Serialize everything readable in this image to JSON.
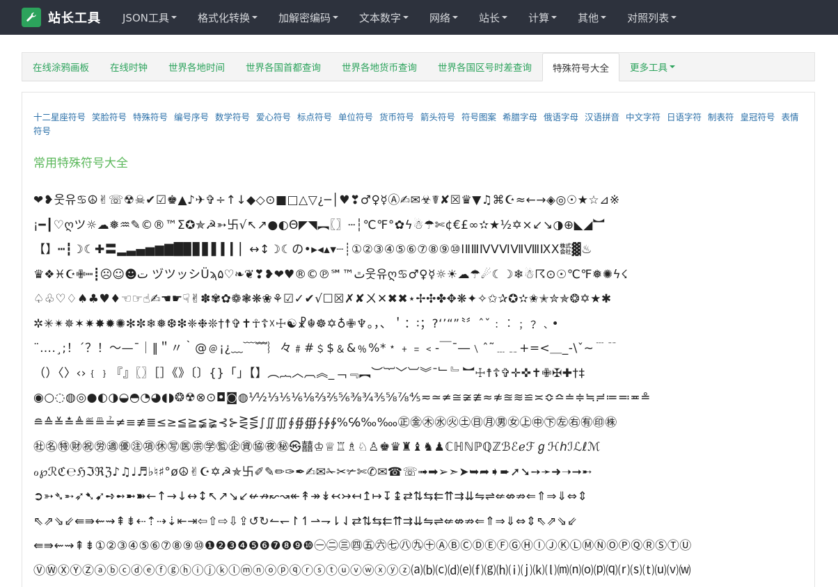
{
  "brand": {
    "name": "站长工具",
    "icon": "wrench-icon"
  },
  "nav": [
    "JSON工具",
    "格式化转换",
    "加解密编码",
    "文本数字",
    "网络",
    "站长",
    "计算",
    "其他",
    "对照列表"
  ],
  "tabs": [
    "在线涂鸦画板",
    "在线时钟",
    "世界各地时间",
    "世界各国首都查询",
    "世界各地货币查询",
    "世界各国区号时差查询",
    "特殊符号大全",
    "更多工具"
  ],
  "active_tab": "特殊符号大全",
  "categories": [
    "十二星座符号",
    "笑脸符号",
    "特殊符号",
    "编号序号",
    "数学符号",
    "爱心符号",
    "标点符号",
    "单位符号",
    "货币符号",
    "箭头符号",
    "符号图案",
    "希腊字母",
    "俄语字母",
    "汉语拼音",
    "中文字符",
    "日语字符",
    "制表符",
    "皇冠符号",
    "表情符号"
  ],
  "section_title": "常用特殊符号大全",
  "symbol_rows": [
    "❤❥웃유♋☮✌☏☢☠✔☑♚▲♪✈✞÷↑↓◆◇⊙■□△▽¿─│♥❣♂♀☿Ⓐ✍✉☣☤✘☒♛▼♫⌘☪≈←→◈◎☉★☆⊿※",
    "¡━┃♡ღツ☼☁❅♒✎©®™Σ✪✯☭➳卐√↖↗●◐Θ◤◥︻〖〗┄┆℃℉°✿ϟ☃☂✄¢€£∞✫★½✡×↙↘◑⊕◣◢︼",
    "【】┅┇☽☾✚〓▂▃▄▅▆▇█▉▊▋▌▍▎▏↔↕☽☾の•▸◂▴▾┈┊①②③④⑤⑥⑦⑧⑨⑩ⅠⅡⅢⅣⅤⅥⅦⅧⅨⅩ㍿▓♨",
    "♛❖♓☪✙┉┋☹☺☻ت ヅツッシÜϡﭢ™℠℗©®♥❤❥❣❦❧♡۵웃유ღ♋♂♀☿☼☀☁☂☄☾☽❄☃☈⊙☉℃℉❅✺ϟ☇",
    "♤♧♡♢♠♣♥♦☜☞☝✍☚☛☟✌✽✾✿❁❃❋❀⚘☑✓✔√☐☒✗✘ㄨ✕✖✖⋆✢✣✤✥❋✦✧✩✰✪✫✬✭✮✯❂✡★✱",
    "✲✳✴✵✶✷✸✹✺✻✼❄❅❆❇❈❉❊†☨✞✝☥☦☓☩☯☧☬☸✡♁✙♆。，、＇：∶；?‘’“”〝〞ˆˇ﹕︰﹔﹖﹑•",
    "¨….¸;！´？！～—ˉ｜‖＂〃｀@﹫¡¿﹏﹋﹌︴々﹟#﹩$﹠&﹪%*﹡﹢﹦﹤‐￣¯―﹨ˆ˜﹍﹎+=<＿_-\\ˇ~﹉﹊",
    "（）〈〉‹›﹛﹜『』〖〗［］《》〔〕{}「」【】︵︷︿︹︽_﹁﹃︻︶︸﹀︺︾ˉ﹂﹄︼☩☨☦✞✛✜✝✙✠✚†‡",
    "◉○◌◍◎●◐◑◒◓◔◕◖◗❂☢⊗⊙◘◙◍⅟½⅓⅕⅙⅛⅔⅖⅚⅜¾⅗⅝⅞⅘≂≃≄≅≆≇≈≉≊≋≌≍≎≏≐≑≒≓≔≕≖≗",
    "≘≙≚≛≜≝≞≟≠≡≢≣≤≥≦≧≨≩⊰⊱⋛⋚∫∬∭∮∯∰∱∲∳%℅‰‱㊣㊎㊍㊌㊋㊏㊐㊊㊚㊛㊤㊥㊦㊧㊨㊒㊞㊑",
    "㊓㊔㊕㊖㊗㊘㊜㊝㊟㊠㊡㊢㊩㊪㊫㊬㊭㊮㊯㊰㊙㉿囍♔♕♖♗♘♙♚♛♜♝♞♟ℂℍℕℙℚℤℬℰℯℱℊℋℎℐℒℓℳ",
    "ℴ℘ℛℭ℮ℌℑℜℨ♪♫♩♬♭♮♯°ø☮✌☪✡☭✯卐✐✎✏✑✒✍✉✁✂✃✄✆✉☎☏➟➡➢➣➤➥➦➧➨➚➘➙➛➜➝➞➸",
    "➲➳➴➵➶➷➹➺➻➼➽←↑→↓↔↕↖↗↘↙↚↛↜↝↞↟↠↡↢↣↤↥↦↧↨⇄⇅⇆⇇⇈⇉⇊⇋⇌⇍⇎⇏⇐⇑⇒⇓⇔⇕",
    "⇖⇗⇘⇙⇚⇛⇜⇝⇞⇟⇠⇡⇢⇣⇤⇥⇦⇧⇨⇩⇪↺↻↼↽↾↿⇀⇁⇂⇃⇄⇅⇆⇇⇈⇉⇊⇋⇌⇍⇎⇏⇐⇑⇒⇓⇔⇕⇖⇗⇘⇙",
    "⇚⇛⇜⇝⇞⇟①②③④⑤⑥⑦⑧⑨⑩❶❷❸❹❺❻❼❽❾❿㊀㊁㊂㊃㊄㊅㊆㊇㊈㊉ⒶⒷⒸⒹⒺⒻⒼⒽⒾⒿⓀⓁⓂⓃⓄⓅⓆⓇⓈⓉⓊ",
    "ⓋⓌⓍⓎⓏⓐⓑⓒⓓⓔⓕⓖⓗⓘⓙⓚⓛⓜⓝⓞⓟⓠⓡⓢⓣⓤⓥⓦⓧⓨⓩ⒜⒝⒞⒟⒠⒡⒢⒣⒤⒥⒦⒧⒨⒩⒪⒫⒬⒭⒮⒯⒰⒱⒲"
  ],
  "colors": {
    "nav_bg": "#2d323d",
    "brand": "#2ca35c",
    "link": "#2a6fa8",
    "title": "#5cb85c"
  }
}
